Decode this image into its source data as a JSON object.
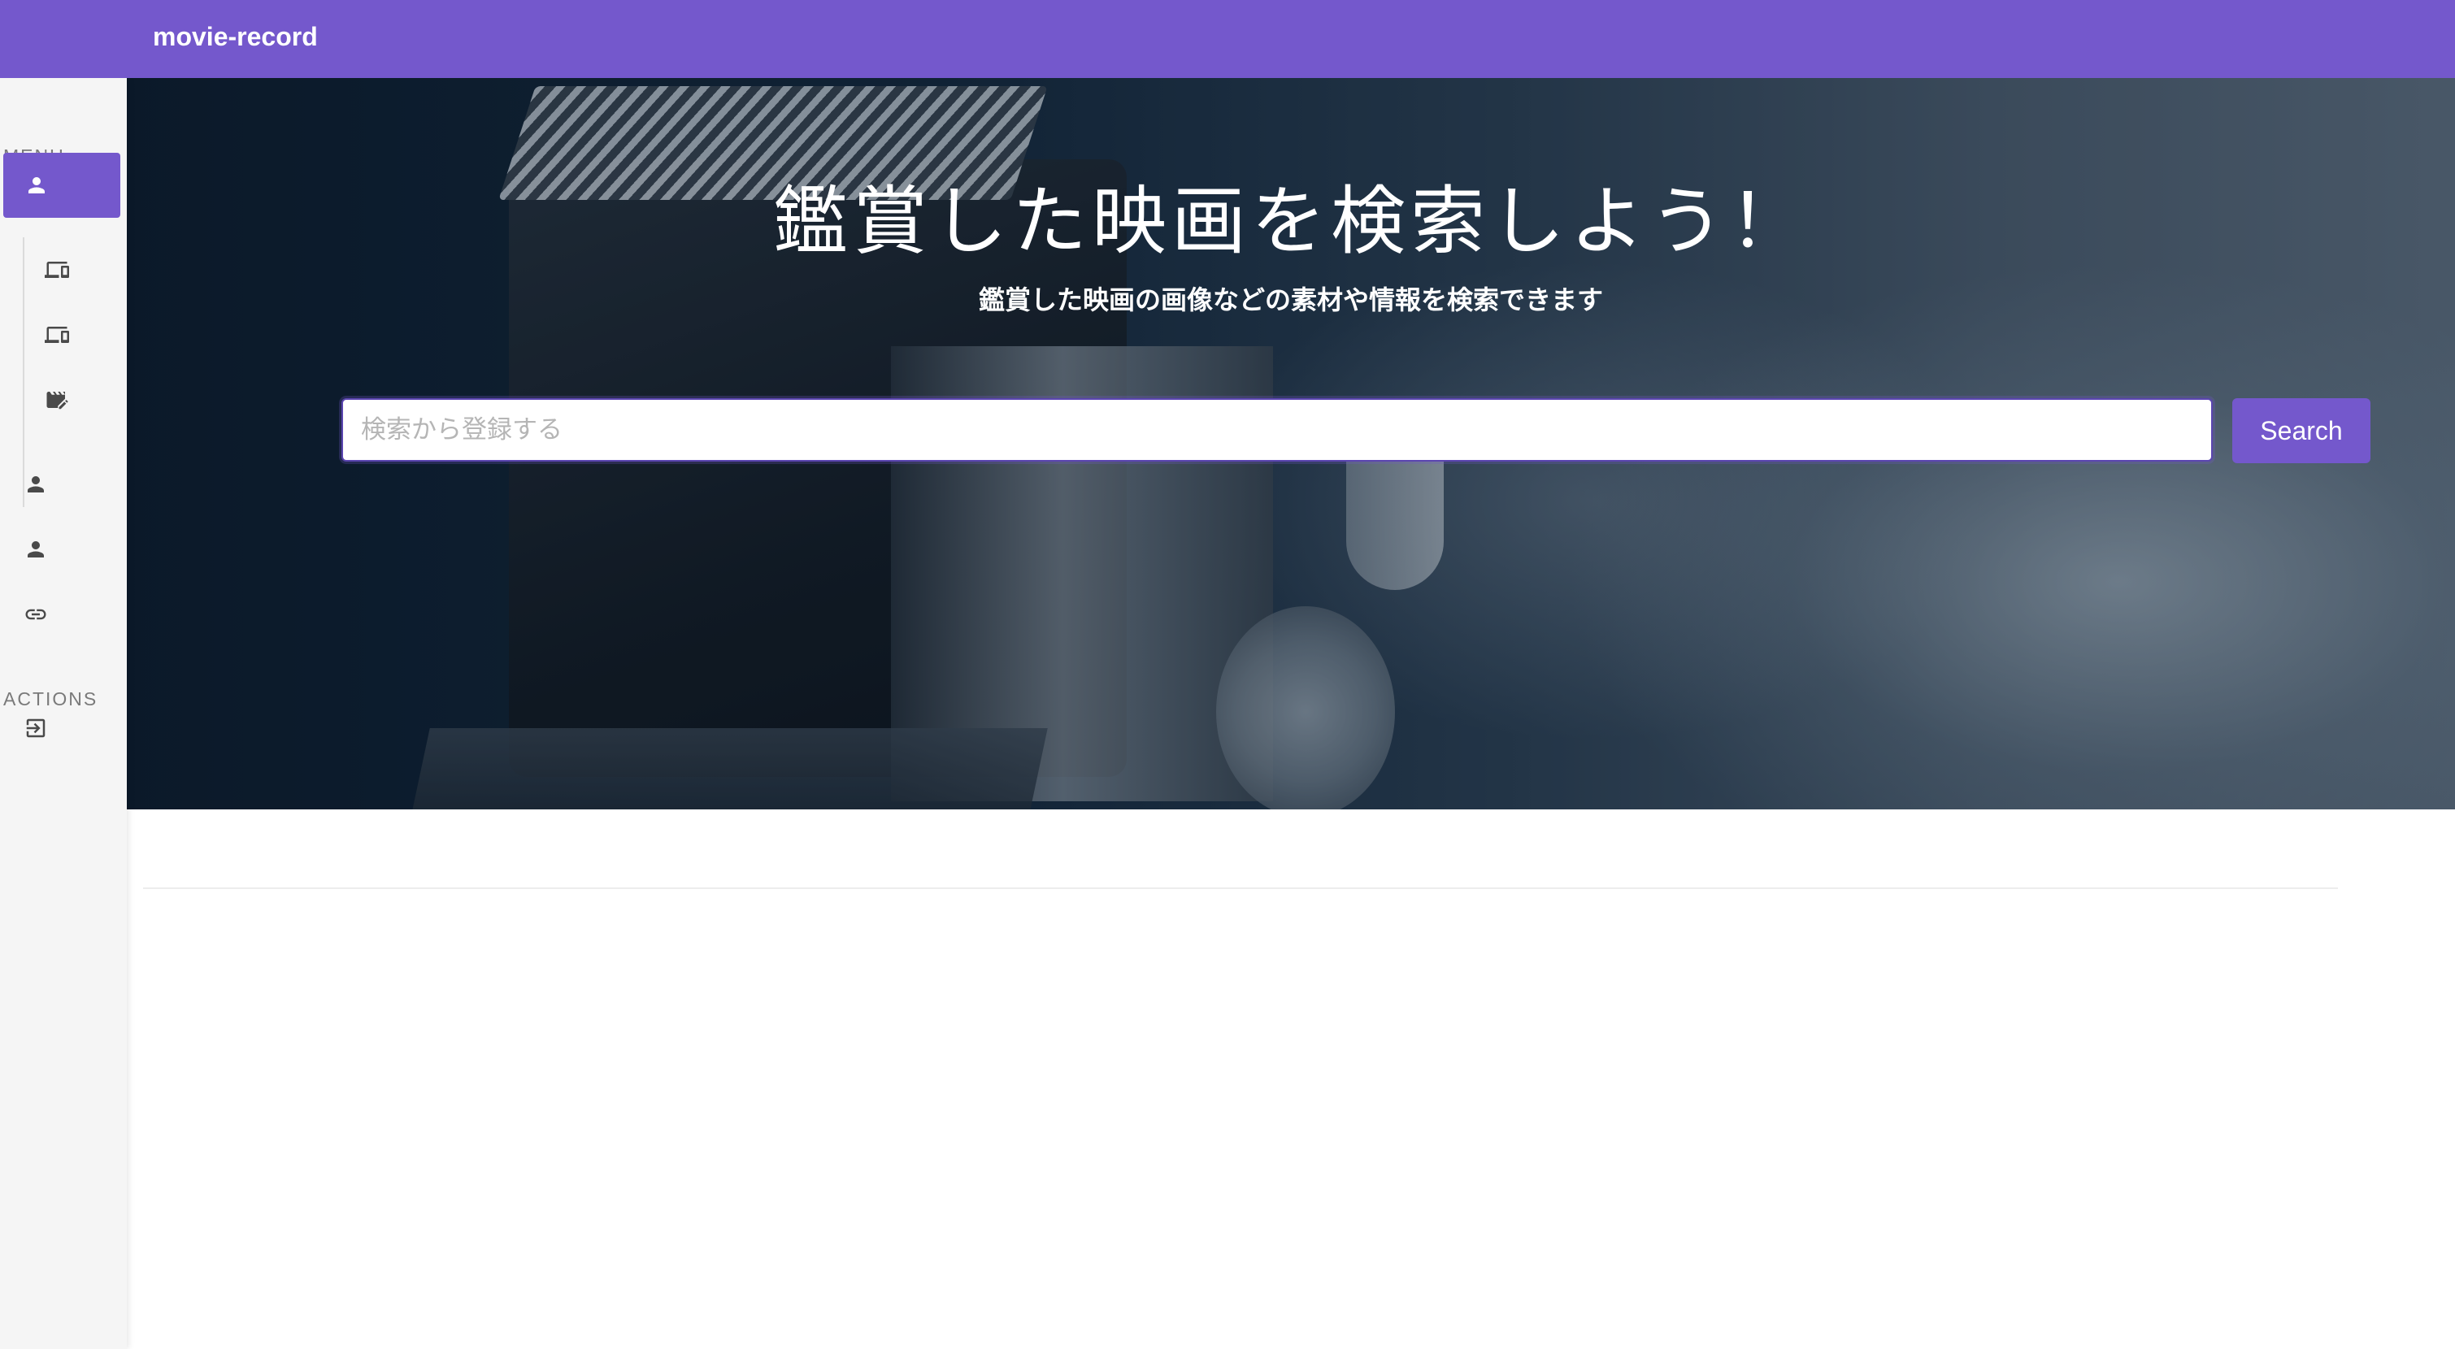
{
  "navbar": {
    "brand": "movie-record"
  },
  "sidebar": {
    "menu_label": "MENU",
    "actions_label": "ACTIONS",
    "items": [
      {
        "icon": "person-icon",
        "active": true
      },
      {
        "icon": "devices-icon"
      },
      {
        "icon": "devices-icon"
      },
      {
        "icon": "movie-edit-icon"
      },
      {
        "icon": "person-icon"
      },
      {
        "icon": "person-icon"
      },
      {
        "icon": "link-icon"
      }
    ],
    "actions": [
      {
        "icon": "logout-icon"
      }
    ]
  },
  "hero": {
    "title": "鑑賞した映画を検索しよう！",
    "subtitle": "鑑賞した映画の画像などの素材や情報を検索できます"
  },
  "search": {
    "value": "",
    "placeholder": "検索から登録する",
    "button_label": "Search"
  },
  "colors": {
    "primary": "#7458cc",
    "sidebar_bg": "#f5f5f5"
  }
}
